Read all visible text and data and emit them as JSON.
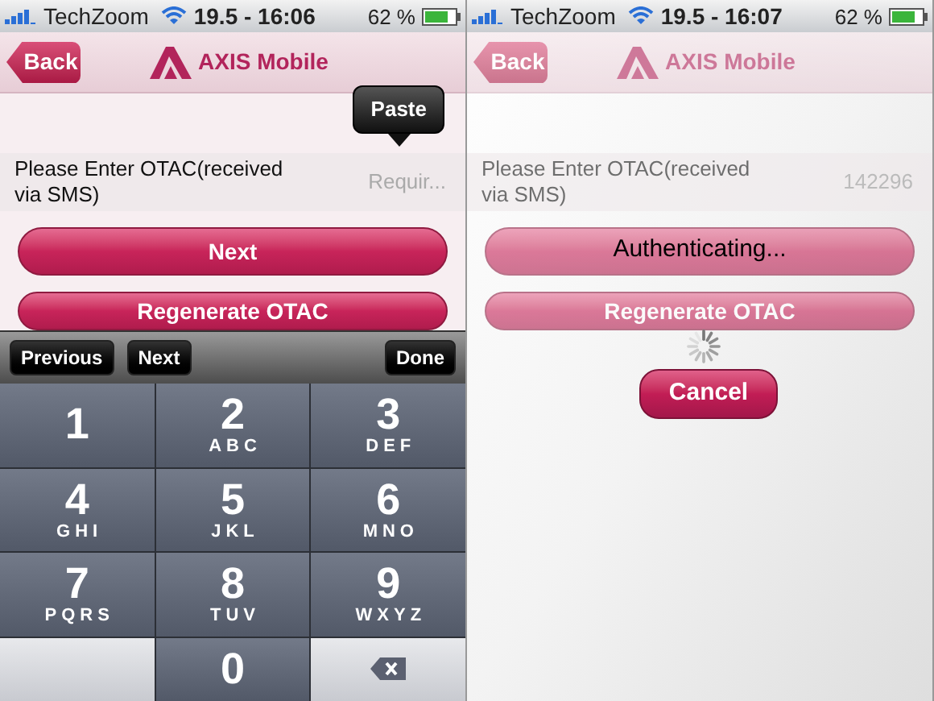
{
  "screens": [
    {
      "kind": "entry",
      "dimmed": false,
      "status_bar": {
        "carrier": "TechZoom",
        "time": "19.5 - 16:06",
        "battery": "62 %"
      },
      "nav": {
        "back": "Back",
        "title": "AXIS Mobile"
      },
      "paste_menu": {
        "label": "Paste"
      },
      "field": {
        "label": "Please Enter OTAC(received via SMS)",
        "placeholder": "Requir..."
      },
      "buttons": [
        {
          "kind": "labeled",
          "label": "Next"
        },
        {
          "kind": "labeled",
          "label": "Regenerate OTAC"
        }
      ],
      "keyboard": {
        "toolbar": [
          {
            "label": "Previous"
          },
          {
            "label": "Next"
          },
          {
            "label": "Done"
          }
        ],
        "keys": [
          {
            "kind": "digit",
            "digit": "1"
          },
          {
            "kind": "digit",
            "digit": "2",
            "letters": "ABC"
          },
          {
            "kind": "digit",
            "digit": "3",
            "letters": "DEF"
          },
          {
            "kind": "digit",
            "digit": "4",
            "letters": "GHI"
          },
          {
            "kind": "digit",
            "digit": "5",
            "letters": "JKL"
          },
          {
            "kind": "digit",
            "digit": "6",
            "letters": "MNO"
          },
          {
            "kind": "digit",
            "digit": "7",
            "letters": "PQRS"
          },
          {
            "kind": "digit",
            "digit": "8",
            "letters": "TUV"
          },
          {
            "kind": "digit",
            "digit": "9",
            "letters": "WXYZ"
          },
          {
            "kind": "blank"
          },
          {
            "kind": "digit",
            "digit": "0"
          },
          {
            "kind": "delete"
          }
        ]
      }
    },
    {
      "kind": "progress",
      "dimmed": true,
      "status_bar": {
        "carrier": "TechZoom",
        "time": "19.5 - 16:07",
        "battery": "62 %"
      },
      "nav": {
        "back": "Back",
        "title": "AXIS Mobile"
      },
      "field": {
        "label": "Please Enter OTAC(received via SMS)",
        "value": "142296"
      },
      "buttons": [
        {
          "kind": "blank"
        },
        {
          "kind": "labeled",
          "label": "Regenerate OTAC"
        }
      ],
      "overlay": {
        "message": "Authenticating...",
        "cancel": "Cancel"
      }
    }
  ]
}
